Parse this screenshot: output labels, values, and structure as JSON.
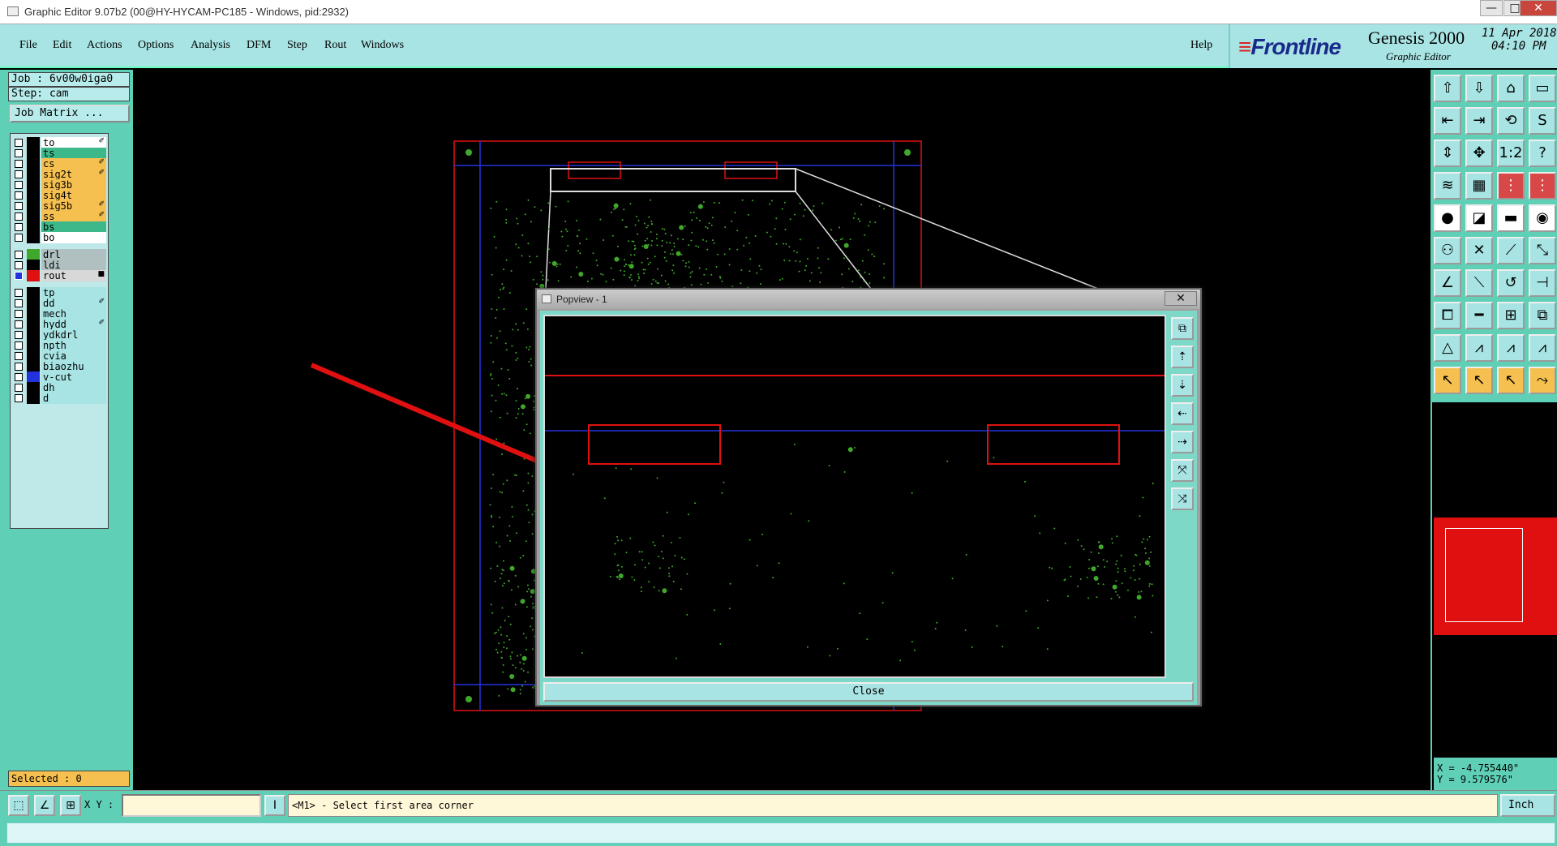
{
  "window": {
    "title": "Graphic Editor 9.07b2 (00@HY-HYCAM-PC185 - Windows, pid:2932)",
    "minimize": "—",
    "maximize": "□",
    "close": "✕"
  },
  "menu": {
    "items": [
      "File",
      "Edit",
      "Actions",
      "Options",
      "Analysis",
      "DFM",
      "Step",
      "Rout",
      "Windows"
    ],
    "help": "Help"
  },
  "brand": {
    "logo": "Frontline",
    "product": "Genesis 2000",
    "subtitle": "Graphic Editor",
    "date": "11 Apr 2018",
    "time": "04:10 PM"
  },
  "job": {
    "job_label": "Job : 6v00w0iga0",
    "step_label": "Step: cam",
    "matrix_button": "Job Matrix ..."
  },
  "layers": [
    {
      "name": "to",
      "color": "#ffffff",
      "mark": "✐"
    },
    {
      "name": "ts",
      "color": "#3db88a",
      "mark": ""
    },
    {
      "name": "cs",
      "color": "#f6c050",
      "mark": "✐"
    },
    {
      "name": "sig2t",
      "color": "#f6c050",
      "mark": "✐"
    },
    {
      "name": "sig3b",
      "color": "#f6c050",
      "mark": ""
    },
    {
      "name": "sig4t",
      "color": "#f6c050",
      "mark": ""
    },
    {
      "name": "sig5b",
      "color": "#f6c050",
      "mark": "✐"
    },
    {
      "name": "ss",
      "color": "#f6c050",
      "mark": "✐"
    },
    {
      "name": "bs",
      "color": "#3db88a",
      "mark": ""
    },
    {
      "name": "bo",
      "color": "#ffffff",
      "mark": ""
    },
    {
      "name": "drl",
      "color": "#b0c0c0",
      "mark": ""
    },
    {
      "name": "ldi",
      "color": "#b0c0c0",
      "mark": ""
    },
    {
      "name": "rout",
      "color": "#d8d8d8",
      "mark": "■"
    },
    {
      "name": "tp",
      "color": "#a8e4e4",
      "mark": ""
    },
    {
      "name": "dd",
      "color": "#a8e4e4",
      "mark": "✐"
    },
    {
      "name": "mech",
      "color": "#a8e4e4",
      "mark": ""
    },
    {
      "name": "hydd",
      "color": "#a8e4e4",
      "mark": "✐"
    },
    {
      "name": "ydkdrl",
      "color": "#a8e4e4",
      "mark": ""
    },
    {
      "name": "npth",
      "color": "#a8e4e4",
      "mark": ""
    },
    {
      "name": "cvia",
      "color": "#a8e4e4",
      "mark": ""
    },
    {
      "name": "biaozhu",
      "color": "#a8e4e4",
      "mark": ""
    },
    {
      "name": "v-cut",
      "color": "#a8e4e4",
      "mark": ""
    },
    {
      "name": "dh",
      "color": "#a8e4e4",
      "mark": ""
    },
    {
      "name": "d",
      "color": "#a8e4e4",
      "mark": ""
    }
  ],
  "selected": "Selected : 0",
  "popview": {
    "title": "Popview - 1",
    "close_x": "✕",
    "close_button": "Close"
  },
  "coords": {
    "x": "X = -4.755440\"",
    "y": "Y = 9.579576\""
  },
  "status": {
    "xy_label": "X Y :",
    "prompt": "<M1> - Select first area corner",
    "units": "Inch"
  },
  "colors": {
    "panel": "#5fd0b6",
    "menu": "#a8e4e4",
    "profile": "#e01010",
    "datum": "#2233dd",
    "pads": "#3fa82a"
  }
}
